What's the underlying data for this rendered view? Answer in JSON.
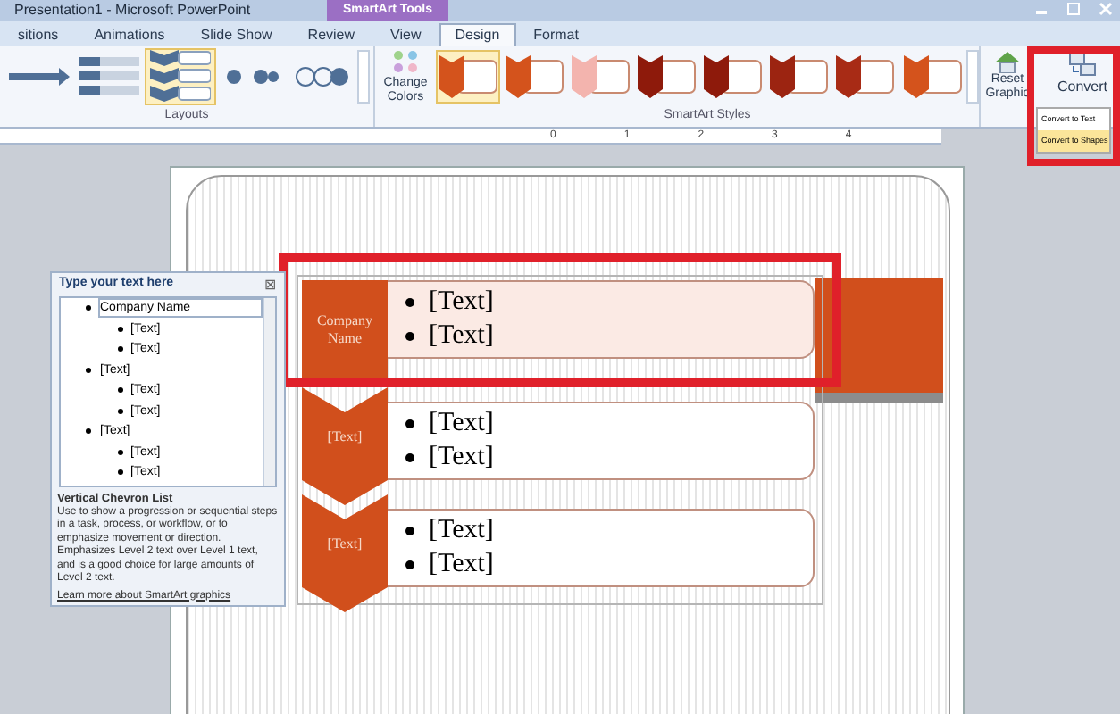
{
  "window": {
    "title": "Presentation1  -  Microsoft PowerPoint",
    "context_tab": "SmartArt Tools"
  },
  "tabs": [
    {
      "label": "sitions",
      "selected": false
    },
    {
      "label": "Animations",
      "selected": false
    },
    {
      "label": "Slide Show",
      "selected": false
    },
    {
      "label": "Review",
      "selected": false
    },
    {
      "label": "View",
      "selected": false
    },
    {
      "label": "Design",
      "selected": true
    },
    {
      "label": "Format",
      "selected": false
    }
  ],
  "layouts": {
    "label": "Layouts",
    "items": [
      {
        "kind": "arrow",
        "selected": false
      },
      {
        "kind": "stack",
        "selected": false
      },
      {
        "kind": "chevron",
        "selected": true
      },
      {
        "kind": "dots",
        "selected": false
      },
      {
        "kind": "circles",
        "selected": false
      }
    ]
  },
  "change_colors": {
    "label": "Change Colors"
  },
  "styles": {
    "label": "SmartArt Styles",
    "items": [
      {
        "color": "#d4531c",
        "selected": true
      },
      {
        "color": "#d4531c",
        "selected": false
      },
      {
        "color": "#f3b4ae",
        "selected": false
      },
      {
        "color": "#8e1a0b",
        "selected": false
      },
      {
        "color": "#8e1a0b",
        "selected": false
      },
      {
        "color": "#9c2411",
        "selected": false
      },
      {
        "color": "#a82b15",
        "selected": false
      },
      {
        "color": "#d4531c",
        "selected": false
      }
    ]
  },
  "reset": {
    "label": "Reset Graphic"
  },
  "convert": {
    "label": "Convert",
    "menu": [
      {
        "label": "Convert to Text",
        "selected": false
      },
      {
        "label": "Convert to Shapes",
        "selected": true
      }
    ]
  },
  "ruler": [
    "0",
    "1",
    "2",
    "3",
    "4"
  ],
  "text_pane": {
    "title": "Type your text here",
    "close": "⊠",
    "items": [
      {
        "text": "Company Name",
        "selected": true,
        "children": [
          {
            "text": "[Text]"
          },
          {
            "text": "[Text]"
          }
        ]
      },
      {
        "text": "[Text]",
        "selected": false,
        "children": [
          {
            "text": "[Text]"
          },
          {
            "text": "[Text]"
          }
        ]
      },
      {
        "text": "[Text]",
        "selected": false,
        "children": [
          {
            "text": "[Text]"
          },
          {
            "text": "[Text]"
          }
        ]
      }
    ],
    "description_title": "Vertical Chevron List",
    "description": "Use to show a progression or sequential steps in a task, process, or workflow, or to emphasize movement or direction. Emphasizes Level 2 text over Level 1 text, and is a good choice for large amounts of Level 2 text.",
    "link": "Learn more about SmartArt graphics"
  },
  "smartart": [
    {
      "label": "Company Name",
      "selected": true,
      "bullets": [
        "[Text]",
        "[Text]"
      ]
    },
    {
      "label": "[Text]",
      "selected": false,
      "bullets": [
        "[Text]",
        "[Text]"
      ]
    },
    {
      "label": "[Text]",
      "selected": false,
      "bullets": [
        "[Text]",
        "[Text]"
      ]
    }
  ]
}
